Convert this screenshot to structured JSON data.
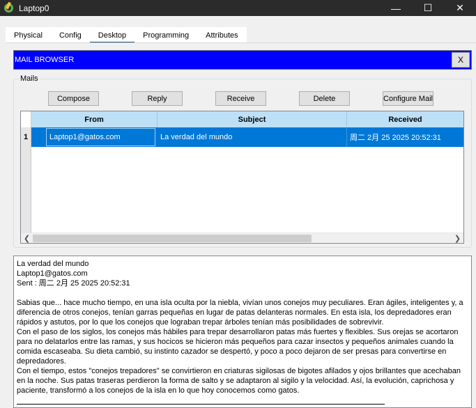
{
  "window": {
    "title": "Laptop0",
    "minimize": "—",
    "maximize": "☐",
    "close": "✕"
  },
  "tabs": [
    "Physical",
    "Config",
    "Desktop",
    "Programming",
    "Attributes"
  ],
  "active_tab": "Desktop",
  "mail_browser": {
    "title": "MAIL BROWSER",
    "close_label": "X"
  },
  "mails": {
    "legend": "Mails",
    "buttons": {
      "compose": "Compose",
      "reply": "Reply",
      "receive": "Receive",
      "delete": "Delete",
      "configure": "Configure Mail"
    },
    "columns": [
      "From",
      "Subject",
      "Received"
    ],
    "rows": [
      {
        "index": "1",
        "from": "Laptop1@gatos.com",
        "subject": "La verdad del mundo",
        "received": "周二 2月 25 2025 20:52:31"
      }
    ]
  },
  "message": {
    "subject": "La verdad del mundo",
    "from": "Laptop1@gatos.com",
    "sent": "Sent : 周二 2月 25 2025 20:52:31",
    "body": "Sabias que... hace mucho tiempo, en una isla oculta por la niebla, vivían unos conejos muy peculiares. Eran ágiles, inteligentes y, a diferencia de otros conejos, tenían garras pequeñas en lugar de patas delanteras normales. En esta isla, los depredadores eran rápidos y astutos, por lo que los conejos que lograban trepar árboles tenían más posibilidades de sobrevivir.\nCon el paso de los siglos, los conejos más hábiles para trepar desarrollaron patas más fuertes y flexibles. Sus orejas se acortaron para no delatarlos entre las ramas, y sus hocicos se hicieron más pequeños para cazar insectos y pequeños animales cuando la comida escaseaba. Su dieta cambió, su instinto cazador se despertó, y poco a poco dejaron de ser presas para convertirse en depredadores.\nCon el tiempo, estos \"conejos trepadores\" se convirtieron en criaturas sigilosas de bigotes afilados y ojos brillantes que acechaban en la noche. Sus patas traseras perdieron la forma de salto y se adaptaron al sigilo y la velocidad. Así, la evolución, caprichosa y paciente, transformó a los conejos de la isla en lo que hoy conocemos como gatos."
  },
  "colors": {
    "title_bar": "#2b2b2b",
    "header_blue": "#0000ff",
    "selection": "#0078d7",
    "grid_header": "#bde0f7"
  }
}
